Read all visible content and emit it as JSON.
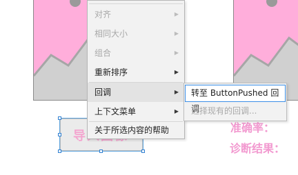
{
  "menu": {
    "items": [
      {
        "label": "",
        "enabled": false,
        "has_submenu": false
      },
      {
        "label": "对齐",
        "enabled": false,
        "has_submenu": true
      },
      {
        "label": "相同大小",
        "enabled": false,
        "has_submenu": true
      },
      {
        "label": "组合",
        "enabled": false,
        "has_submenu": true
      },
      {
        "label": "重新排序",
        "enabled": true,
        "has_submenu": true
      },
      {
        "label": "回调",
        "enabled": true,
        "has_submenu": true
      },
      {
        "label": "上下文菜单",
        "enabled": true,
        "has_submenu": true
      },
      {
        "label": "关于所选内容的帮助",
        "enabled": true,
        "has_submenu": false
      }
    ],
    "submenu_arrow": "▶"
  },
  "submenu": {
    "items": [
      {
        "label": "转至 ButtonPushed 回调",
        "enabled": true
      },
      {
        "label": "选择现有的回调...",
        "enabled": false
      }
    ]
  },
  "canvas": {
    "button_caption": "导入图像",
    "label_accuracy": "准确率：",
    "label_result": "诊断结果："
  },
  "colors": {
    "pink_fill": "#ffaedb",
    "gray_fill": "#cfcfcf",
    "label_pink": "#f29ad0",
    "selection_blue": "#2f7fd1"
  },
  "icons": {
    "left_image": "image-placeholder-icon",
    "right_image": "image-placeholder-icon"
  }
}
